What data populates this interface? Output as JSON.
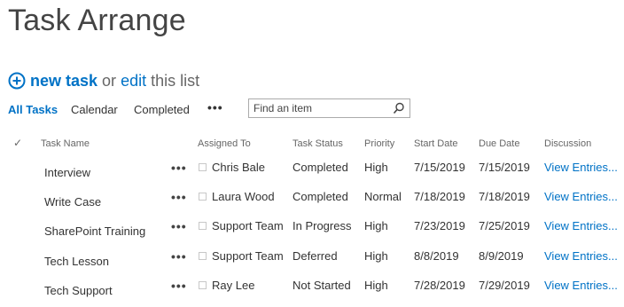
{
  "page": {
    "title": "Task Arrange"
  },
  "actions": {
    "new_task": "new task",
    "or": "or",
    "edit": "edit",
    "this_list": "this list"
  },
  "views": {
    "all_tasks": "All Tasks",
    "calendar": "Calendar",
    "completed": "Completed",
    "more": "•••"
  },
  "search": {
    "placeholder": "Find an item"
  },
  "columns": {
    "check": "✓",
    "task_name": "Task Name",
    "assigned_to": "Assigned To",
    "task_status": "Task Status",
    "priority": "Priority",
    "start_date": "Start Date",
    "due_date": "Due Date",
    "discussion": "Discussion"
  },
  "rows": [
    {
      "name": "Interview",
      "menu": "•••",
      "assigned": "Chris Bale",
      "status": "Completed",
      "priority": "High",
      "start": "7/15/2019",
      "due": "7/15/2019",
      "discussion": "View Entries..."
    },
    {
      "name": "Write Case",
      "menu": "•••",
      "assigned": "Laura Wood",
      "status": "Completed",
      "priority": "Normal",
      "start": "7/18/2019",
      "due": "7/18/2019",
      "discussion": "View Entries..."
    },
    {
      "name": "SharePoint Training",
      "menu": "•••",
      "assigned": "Support Team",
      "status": "In Progress",
      "priority": "High",
      "start": "7/23/2019",
      "due": "7/25/2019",
      "discussion": "View Entries..."
    },
    {
      "name": "Tech Lesson",
      "menu": "•••",
      "assigned": "Support Team",
      "status": "Deferred",
      "priority": "High",
      "start": "8/8/2019",
      "due": "8/9/2019",
      "discussion": "View Entries..."
    },
    {
      "name": "Tech Support",
      "menu": "•••",
      "assigned": "Ray Lee",
      "status": "Not Started",
      "priority": "High",
      "start": "7/28/2019",
      "due": "7/29/2019",
      "discussion": "View Entries..."
    }
  ],
  "colors": {
    "accent": "#0072c6",
    "text": "#333333",
    "muted": "#666666"
  }
}
